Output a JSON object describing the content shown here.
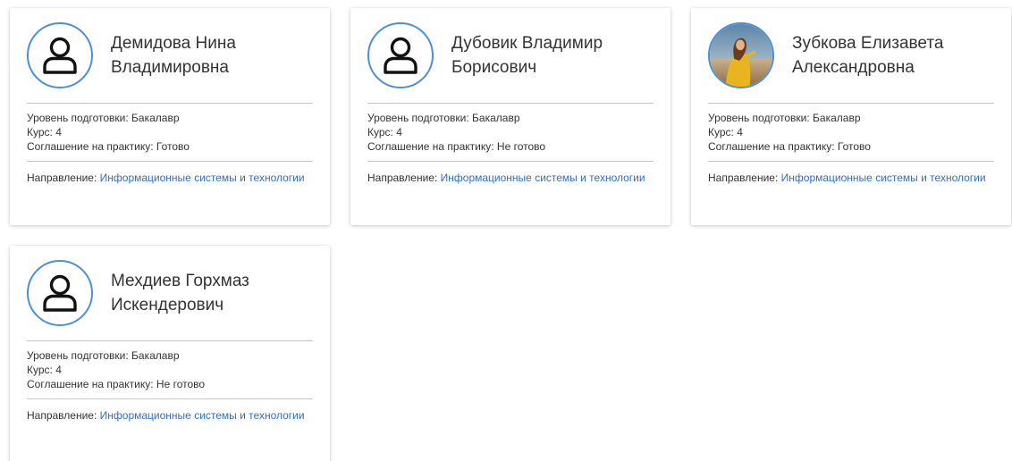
{
  "labels": {
    "level": "Уровень подготовки:",
    "course": "Курс:",
    "agreement": "Соглашение на практику:",
    "direction": "Направление:"
  },
  "students": [
    {
      "name": "Демидова Нина Владимировна",
      "avatar": "user-placeholder-icon",
      "level": "Бакалавр",
      "course": "4",
      "agreement": "Готово",
      "direction": "Информационные системы и технологии"
    },
    {
      "name": "Дубовик Владимир Борисович",
      "avatar": "user-placeholder-icon",
      "level": "Бакалавр",
      "course": "4",
      "agreement": "Не готово",
      "direction": "Информационные системы и технологии"
    },
    {
      "name": "Зубкова Елизавета Александровна",
      "avatar": "photo",
      "level": "Бакалавр",
      "course": "4",
      "agreement": "Готово",
      "direction": "Информационные системы и технологии"
    },
    {
      "name": "Мехдиев Горхмаз Искендерович",
      "avatar": "user-placeholder-icon",
      "level": "Бакалавр",
      "course": "4",
      "agreement": "Не готово",
      "direction": "Информационные системы и технологии"
    }
  ],
  "colors": {
    "avatar_border": "#4a90d9",
    "link": "#2f6fc4",
    "text": "#333333"
  }
}
